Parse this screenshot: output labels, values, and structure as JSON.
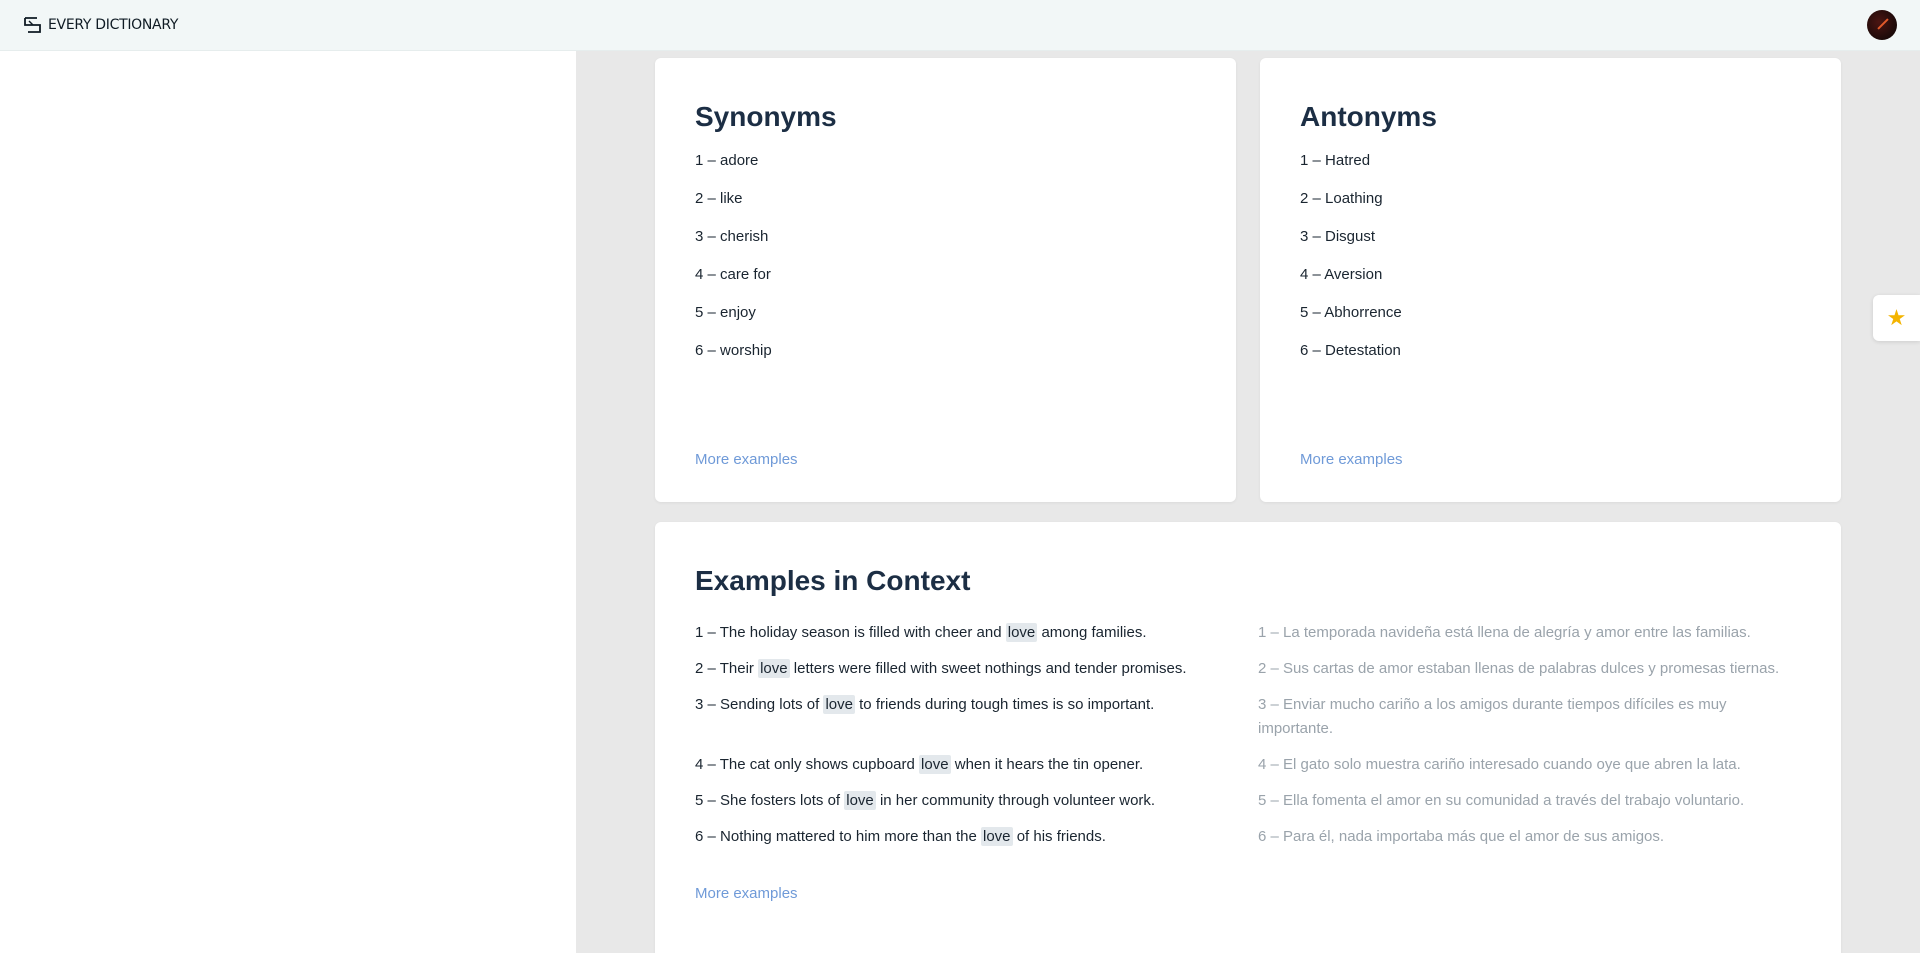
{
  "header": {
    "logo_text": "EVERY DICTIONARY"
  },
  "synonyms": {
    "title": "Synonyms",
    "items": [
      "1 – adore",
      "2 – like",
      "3 – cherish",
      "4 – care for",
      "5 – enjoy",
      "6 – worship"
    ],
    "more_label": "More examples"
  },
  "antonyms": {
    "title": "Antonyms",
    "items": [
      "1 – Hatred",
      "2 – Loathing",
      "3 – Disgust",
      "4 – Aversion",
      "5 – Abhorrence",
      "6 – Detestation"
    ],
    "more_label": "More examples"
  },
  "examples": {
    "title": "Examples in Context",
    "highlight_word": "love",
    "rows": [
      {
        "en_before": "1 – The holiday season is filled with cheer and ",
        "en_after": " among families.",
        "es": "1 – La temporada navideña está llena de alegría y amor entre las familias."
      },
      {
        "en_before": "2 – Their ",
        "en_after": " letters were filled with sweet nothings and tender promises.",
        "es": "2 – Sus cartas de amor estaban llenas de palabras dulces y promesas tiernas."
      },
      {
        "en_before": "3 – Sending lots of ",
        "en_after": " to friends during tough times is so important.",
        "es": "3 – Enviar mucho cariño a los amigos durante tiempos difíciles es muy importante."
      },
      {
        "en_before": "4 – The cat only shows cupboard ",
        "en_after": " when it hears the tin opener.",
        "es": "4 – El gato solo muestra cariño interesado cuando oye que abren la lata."
      },
      {
        "en_before": "5 – She fosters lots of ",
        "en_after": " in her community through volunteer work.",
        "es": "5 – Ella fomenta el amor en su comunidad a través del trabajo voluntario."
      },
      {
        "en_before": "6 – Nothing mattered to him more than the ",
        "en_after": " of his friends.",
        "es": "6 – Para él, nada importaba más que el amor de sus amigos."
      }
    ],
    "more_label": "More examples"
  },
  "icons": {
    "logo": "logo-icon",
    "avatar": "avatar",
    "favorite": "star-icon"
  },
  "colors": {
    "accent_link": "#6f9ad8",
    "star": "#f4b400",
    "heading": "#1c2e44"
  }
}
